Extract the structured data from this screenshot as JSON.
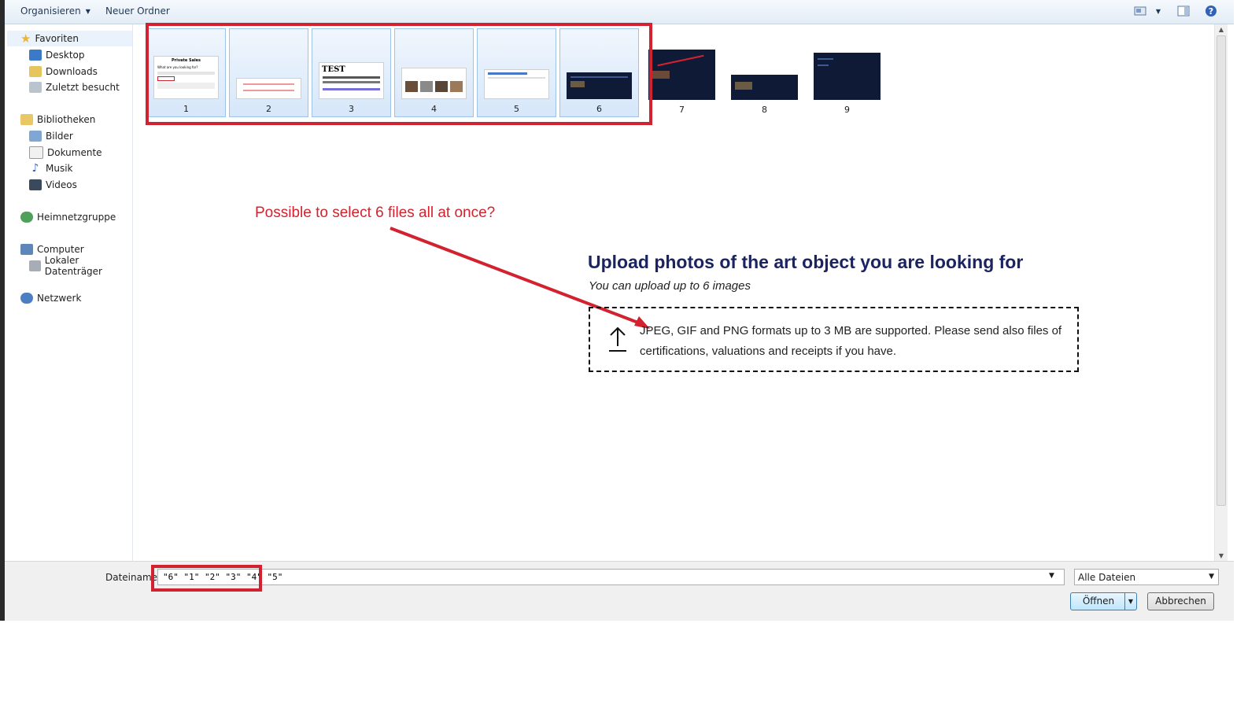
{
  "toolbar": {
    "organize_label": "Organisieren",
    "new_folder_label": "Neuer Ordner"
  },
  "nav": {
    "favorites": "Favoriten",
    "desktop": "Desktop",
    "downloads": "Downloads",
    "recent": "Zuletzt besucht",
    "libraries": "Bibliotheken",
    "pictures": "Bilder",
    "documents": "Dokumente",
    "music": "Musik",
    "videos": "Videos",
    "homegroup": "Heimnetzgruppe",
    "computer": "Computer",
    "local_disk": "Lokaler Datenträger",
    "network": "Netzwerk"
  },
  "files": [
    {
      "label": "1",
      "selected": true,
      "thumb_title": "Private Sales",
      "thumb_heading": "What are you looking for?"
    },
    {
      "label": "2",
      "selected": true
    },
    {
      "label": "3",
      "selected": true,
      "thumb_title": "TEST"
    },
    {
      "label": "4",
      "selected": true
    },
    {
      "label": "5",
      "selected": true
    },
    {
      "label": "6",
      "selected": true
    },
    {
      "label": "7",
      "selected": false
    },
    {
      "label": "8",
      "selected": false
    },
    {
      "label": "9",
      "selected": false
    }
  ],
  "annotation": {
    "text": "Possible to select 6 files all at once?",
    "color": "#d3222f"
  },
  "upload": {
    "title": "Upload photos of the art object you are looking for",
    "subtitle": "You can upload up to 6 images",
    "dropzone_text": "JPEG, GIF and PNG formats up to 3 MB are supported. Please send also files of certifications, valuations and receipts if you have."
  },
  "bottom": {
    "filename_label": "Dateiname:",
    "filename_value": "\"6\" \"1\" \"2\" \"3\" \"4\" \"5\"",
    "filetype_value": "Alle Dateien",
    "open_label": "Öffnen",
    "cancel_label": "Abbrechen"
  },
  "colors": {
    "accent": "#1e395b",
    "selection": "#cce4f7",
    "highlight_red": "#d3222f",
    "upload_title": "#1b2460"
  }
}
